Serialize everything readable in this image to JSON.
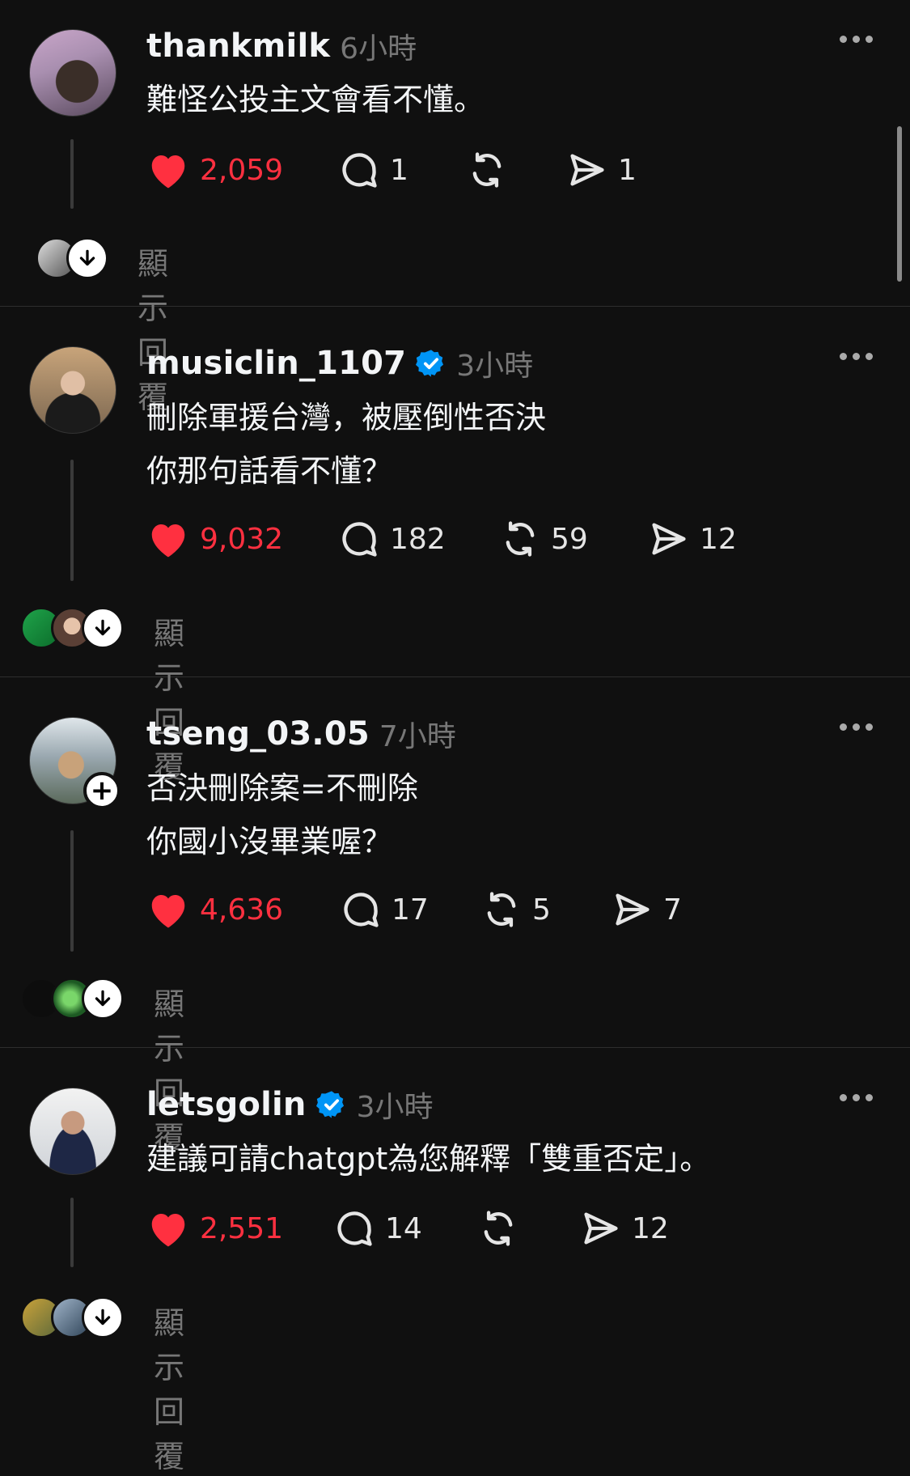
{
  "posts": [
    {
      "username": "thankmilk",
      "time": "6小時",
      "verified": false,
      "lines": [
        "難怪公投主文會看不懂。"
      ],
      "likes": "2,059",
      "comments": "1",
      "reposts": "",
      "shares": "1",
      "show_replies": "顯示回覆"
    },
    {
      "username": "musiclin_1107",
      "time": "3小時",
      "verified": true,
      "lines": [
        "刪除軍援台灣，被壓倒性否決",
        "你那句話看不懂？"
      ],
      "likes": "9,032",
      "comments": "182",
      "reposts": "59",
      "shares": "12",
      "show_replies": "顯示回覆"
    },
    {
      "username": "tseng_03.05",
      "time": "7小時",
      "verified": false,
      "lines": [
        "否決刪除案=不刪除",
        "你國小沒畢業喔？"
      ],
      "likes": "4,636",
      "comments": "17",
      "reposts": "5",
      "shares": "7",
      "show_replies": "顯示回覆"
    },
    {
      "username": "letsgolin",
      "time": "3小時",
      "verified": true,
      "lines": [
        "建議可請chatgpt為您解釋「雙重否定」。"
      ],
      "likes": "2,551",
      "comments": "14",
      "reposts": "",
      "shares": "12",
      "show_replies": "顯示回覆"
    }
  ],
  "colors": {
    "background": "#101010",
    "like": "#ff3040",
    "verified": "#0095f6",
    "muted": "#777777"
  },
  "icons": [
    "heart-icon",
    "comment-icon",
    "repost-icon",
    "share-icon",
    "more-icon",
    "verified-icon",
    "arrow-down-icon",
    "plus-icon"
  ]
}
